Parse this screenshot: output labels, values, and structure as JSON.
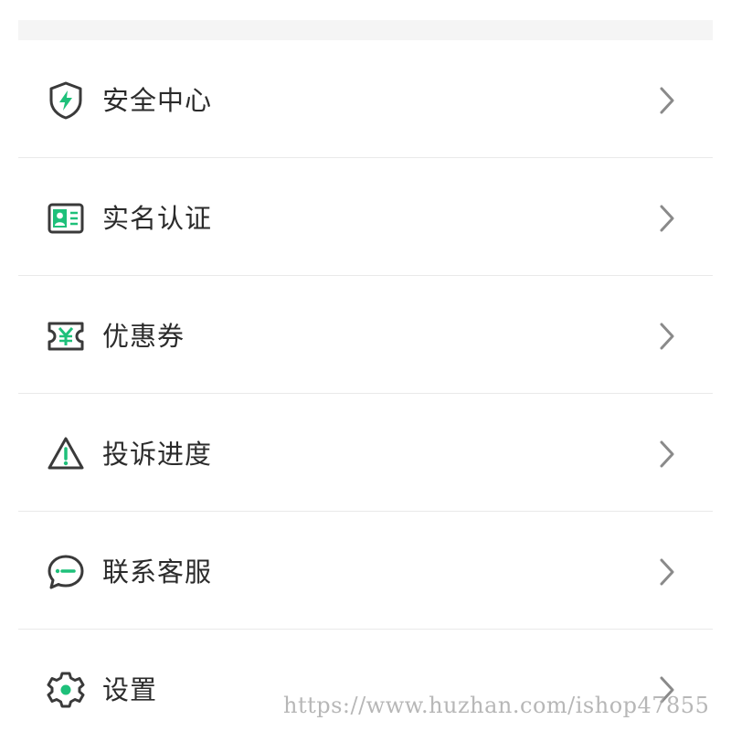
{
  "colors": {
    "accent": "#1ec07a",
    "icon_stroke": "#3a3a3a",
    "chevron": "#8a8a8a",
    "text": "#2b2b2b",
    "divider": "#e9e9e9"
  },
  "menu": {
    "items": [
      {
        "label": "安全中心",
        "icon": "shield-bolt-icon"
      },
      {
        "label": "实名认证",
        "icon": "id-card-icon"
      },
      {
        "label": "优惠券",
        "icon": "coupon-yen-icon"
      },
      {
        "label": "投诉进度",
        "icon": "warning-triangle-icon"
      },
      {
        "label": "联系客服",
        "icon": "chat-bubble-icon"
      },
      {
        "label": "设置",
        "icon": "gear-icon"
      }
    ]
  },
  "watermark": {
    "text": "https://www.huzhan.com/ishop47855"
  }
}
